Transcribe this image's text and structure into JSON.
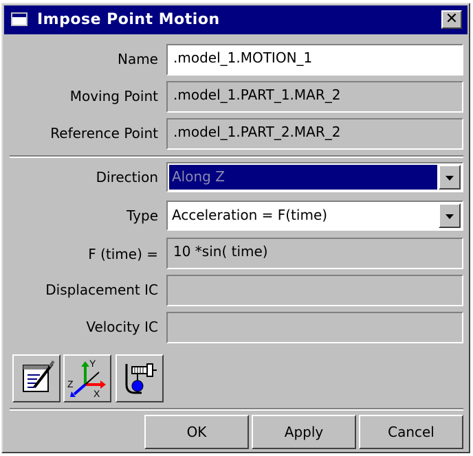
{
  "window": {
    "title": "Impose Point Motion"
  },
  "form": {
    "name_label": "Name",
    "name_value": ".model_1.MOTION_1",
    "moving_point_label": "Moving Point",
    "moving_point_value": ".model_1.PART_1.MAR_2",
    "reference_point_label": "Reference Point",
    "reference_point_value": ".model_1.PART_2.MAR_2",
    "direction_label": "Direction",
    "direction_value": "Along Z",
    "type_label": "Type",
    "type_value": "Acceleration = F(time)",
    "ftime_label": "F (time) =",
    "ftime_value": "10 *sin( time)",
    "displacement_ic_label": "Displacement IC",
    "displacement_ic_value": "",
    "velocity_ic_label": "Velocity IC",
    "velocity_ic_value": ""
  },
  "tools": [
    {
      "icon": "function-builder-icon"
    },
    {
      "icon": "coordinate-axes-icon"
    },
    {
      "icon": "motion-joint-icon"
    }
  ],
  "axis_letters": {
    "y": "Y",
    "z": "Z",
    "x": "X"
  },
  "buttons": {
    "ok_label": "OK",
    "apply_label": "Apply",
    "cancel_label": "Cancel"
  },
  "colors": {
    "title_bar": "#000080",
    "face": "#c0c0c0",
    "selection": "#000080"
  }
}
